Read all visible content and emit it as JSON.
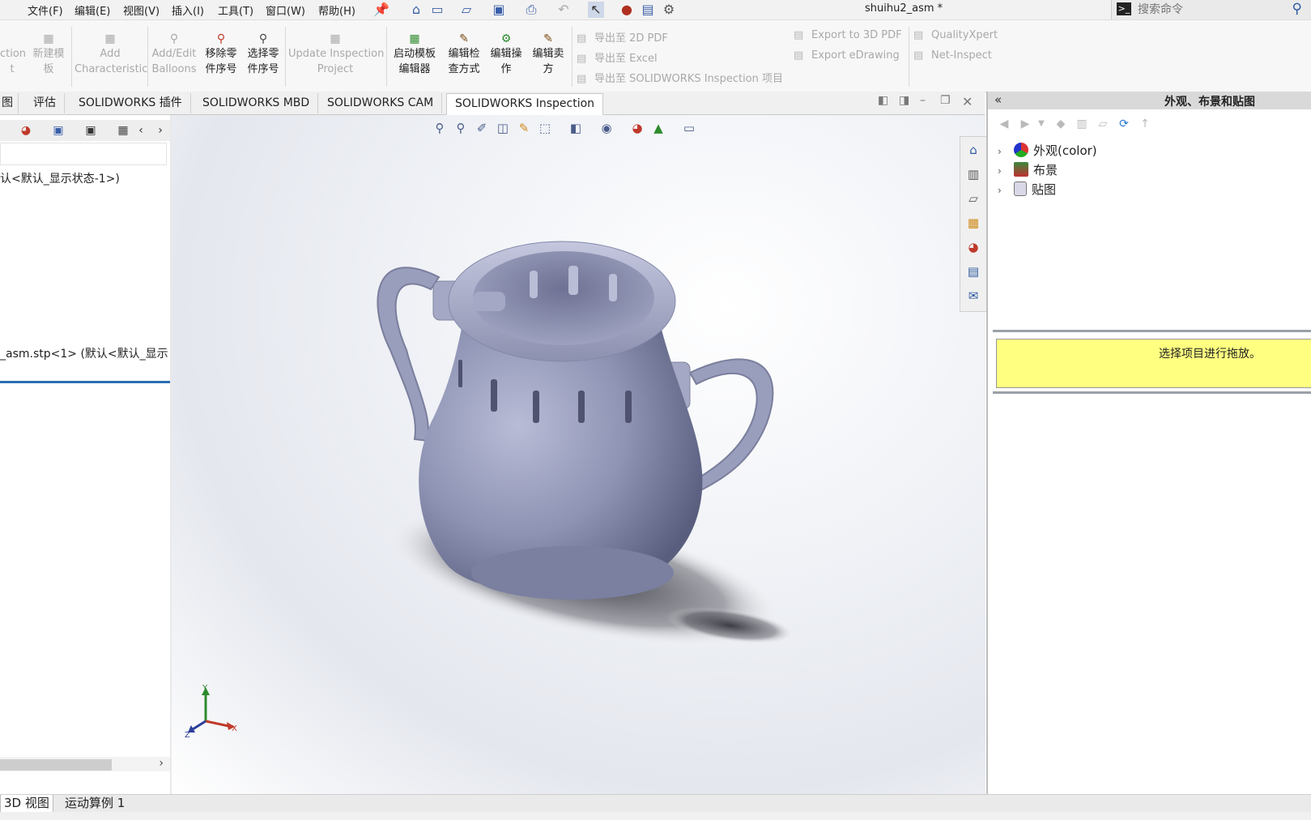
{
  "menubar": {
    "items": [
      "文件(F)",
      "编辑(E)",
      "视图(V)",
      "插入(I)",
      "工具(T)",
      "窗口(W)",
      "帮助(H)"
    ],
    "document_title": "shuihu2_asm *",
    "search_placeholder": "搜索命令"
  },
  "ribbon": {
    "buttons": [
      {
        "label": "ction\nt",
        "icon": "inspection-icon",
        "enabled": false
      },
      {
        "label": "新建模\n板",
        "icon": "new-template-icon",
        "enabled": false
      },
      {
        "label": "Add\nCharacteristic",
        "icon": "add-characteristic-icon",
        "enabled": false
      },
      {
        "label": "Add/Edit\nBalloons",
        "icon": "balloon-icon",
        "enabled": false
      },
      {
        "label": "移除零\n件序号",
        "icon": "remove-balloon-icon",
        "enabled": true
      },
      {
        "label": "选择零\n件序号",
        "icon": "select-balloon-icon",
        "enabled": true
      },
      {
        "label": "Update Inspection\nProject",
        "icon": "update-project-icon",
        "enabled": false
      },
      {
        "label": "启动模板\n编辑器",
        "icon": "template-editor-icon",
        "enabled": true
      },
      {
        "label": "编辑检\n查方式",
        "icon": "edit-inspection-method-icon",
        "enabled": true
      },
      {
        "label": "编辑操\n作",
        "icon": "edit-operation-icon",
        "enabled": true
      },
      {
        "label": "编辑卖\n方",
        "icon": "edit-vendor-icon",
        "enabled": true
      }
    ],
    "export_links": [
      "导出至 2D PDF",
      "导出至 Excel",
      "导出至 SOLIDWORKS Inspection 项目"
    ],
    "export3d_links": [
      "Export to 3D PDF",
      "Export eDrawing"
    ],
    "other_links": [
      "QualityXpert",
      "Net-Inspect"
    ]
  },
  "tabs": [
    {
      "label": "图",
      "active": false
    },
    {
      "label": "评估",
      "active": false
    },
    {
      "label": "SOLIDWORKS 插件",
      "active": false
    },
    {
      "label": "SOLIDWORKS MBD",
      "active": false
    },
    {
      "label": "SOLIDWORKS CAM",
      "active": false
    },
    {
      "label": "SOLIDWORKS Inspection",
      "active": true
    }
  ],
  "left_panel": {
    "config_line": "认<默认_显示状态-1>)",
    "component_line": "_asm.stp<1> (默认<默认_显示"
  },
  "viewport": {
    "triad_labels": {
      "x": "X",
      "y": "Y",
      "z": "Z"
    },
    "model_color": "#8e93b4"
  },
  "right_panel": {
    "title": "外观、布景和贴图",
    "tree": [
      {
        "label": "外观(color)",
        "icon": "appearance-icon"
      },
      {
        "label": "布景",
        "icon": "scene-icon"
      },
      {
        "label": "贴图",
        "icon": "decal-icon"
      }
    ],
    "tip": "选择项目进行拖放。"
  },
  "bottom_tabs": [
    {
      "label": "3D 视图",
      "active": true
    },
    {
      "label": "运动算例 1",
      "active": false
    }
  ],
  "colors": {
    "accent": "#2a6fb0",
    "tip_bg": "#ffff80"
  }
}
